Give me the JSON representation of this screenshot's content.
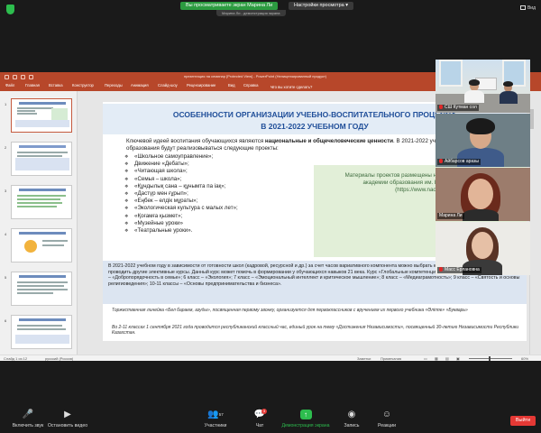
{
  "zoom_top": {
    "share_banner": "Вы просматриваете экран Марина Ли",
    "view_options": "Настройки просмотра",
    "share_sub": "Марина Ли - демонстрация экрана",
    "view_label": "Вид"
  },
  "ppt": {
    "window_title": "презентация на семинар [Protected View] - PowerPoint (Нелицензированный продукт)",
    "menu": [
      "Файл",
      "Главная",
      "Вставка",
      "Конструктор",
      "Переходы",
      "Анимация",
      "Слайд-шоу",
      "Рецензирование",
      "Вид",
      "Справка",
      "Что вы хотите сделать?"
    ],
    "thumb_numbers": [
      "1",
      "2",
      "3",
      "4",
      "5",
      "6"
    ],
    "status": {
      "slide_info": "Слайд 1 из 12",
      "language": "русский (Россия)",
      "notes": "Заметки",
      "comments": "Примечания",
      "zoom": "60%"
    }
  },
  "slide": {
    "title_line1": "ОСОБЕННОСТИ ОРГАНИЗАЦИИ УЧЕБНО-ВОСПИТАТЕЛЬНОГО ПРОЦЕССА",
    "title_line2": "В 2021-2022 УЧЕБНОМ ГОДУ",
    "intro_prefix": "Ключевой идеей воспитания обучающихся являются ",
    "intro_bold": "национальные и общечеловеческие ценности",
    "intro_suffix": ". В 2021-2022 учебном году в организациях образования будут реализовываться следующие проекты:",
    "bullets": [
      "«Школьное самоуправление»;",
      "Движение «Дебаты»;",
      "«Читающая школа»;",
      "«Семья – школа»;",
      "«Құндылық сана – құнымта па іақ»;",
      "«Дастүр мен ғұрып»;",
      "«Еңбек – елдік мұраты»;",
      "«Экологическая культура с малых лет»;",
      "«Қоғамға қызмет»;",
      "«Музейные уроки»",
      "«Театральные уроки»."
    ],
    "green_lines": [
      "Материалы проектов размещены на сайте Национальной",
      "академии образования им. Ы. Алтынсарина",
      "(https://www.nao.kz)"
    ],
    "blue_text": "В 2021-2022 учебном году в зависимости от готовности школ (кадровой, ресурсной и др.) за счет часов вариативного компонента можно выбрать курс «Глобальные компетенции» или проводить другие элективные курсы. Данный курс может помочь в формировании у обучающихся навыков 21 века. Курс «Глобальные компетенции» (1 час в неделю) включает: 5 класс – «Добропорядочность в семье»; 6 класс – «Экология»; 7 класс – «Эмоциональный интеллект и критическое мышление»; 8 класс – «Медиаграмотность»; 9 класс – «Святость и основы религиоведения»; 10-11 классы – «Основы предпринимательства и бизнеса».",
    "italic_1": "Торжественная линейка «Бел бараем, азуды», посвященная первому звонку, организуется для первоклассников с вручением их первого учебника «Әліппе» «Букварь»",
    "italic_2": "Во 2-11 классах 1 сентября 2021 года проводится республиканский классный час, единый урок на тему «Достижения Независимости», посвященный 30-летию Независимости Республики Казахстан."
  },
  "participants": [
    {
      "name": "СШ Кутман сол",
      "muted": true
    },
    {
      "name": "Айбарсов аразы",
      "muted": true
    },
    {
      "name": "Марина Ли",
      "muted": false
    },
    {
      "name": "Масс Ерлановна",
      "muted": true
    }
  ],
  "toolbar": {
    "mic": "Включить звук",
    "video": "Остановить видео",
    "participants": "Участники",
    "participants_count": "57",
    "chat": "Чат",
    "chat_badge": "3",
    "share": "Демонстрация экрана",
    "record": "Запись",
    "reactions": "Реакции",
    "leave": "Выйти"
  },
  "colors": {
    "ppt_accent": "#b7472a",
    "slide_title": "#1f4e99",
    "zoom_green": "#2dbd4e",
    "leave_red": "#e53935"
  }
}
